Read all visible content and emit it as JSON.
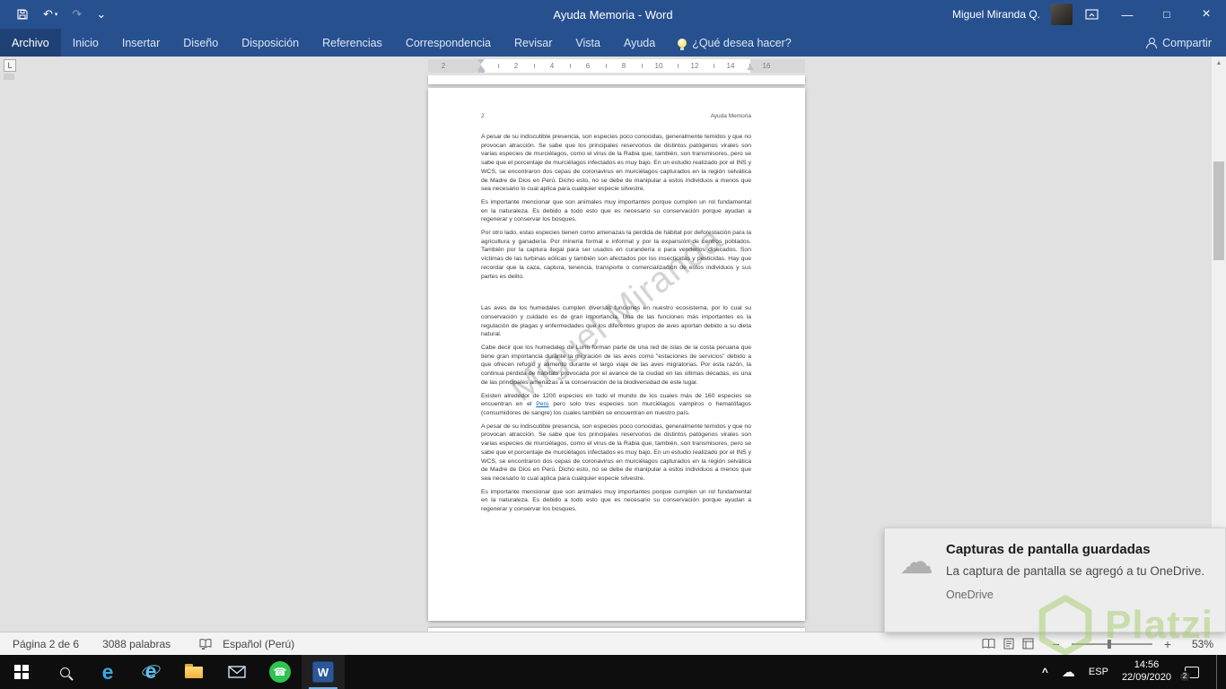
{
  "icons": {
    "undo": "↶",
    "redo": "↷",
    "undo_dropdown": "▾",
    "qat_dropdown": "⌄",
    "minimize": "—",
    "maximize": "□",
    "close": "×",
    "scroll_up": "▲",
    "scroll_down": "▼",
    "cloud": "☁",
    "phone": "☎",
    "tray_chevron": "^",
    "edge_letter": "e",
    "ie_letter": "e",
    "tab_selector": "L",
    "zoom_out": "−",
    "zoom_in": "+",
    "word_logo": "W"
  },
  "title_bar": {
    "title": "Ayuda Memoria - Word",
    "user_name": "Miguel Miranda Q."
  },
  "ribbon": {
    "tabs": [
      "Archivo",
      "Inicio",
      "Insertar",
      "Diseño",
      "Disposición",
      "Referencias",
      "Correspondencia",
      "Revisar",
      "Vista",
      "Ayuda"
    ],
    "tell_me": "¿Qué desea hacer?",
    "share": "Compartir"
  },
  "ruler": {
    "numbers": [
      "2",
      "2",
      "4",
      "6",
      "8",
      "10",
      "12",
      "14",
      "16"
    ]
  },
  "doc": {
    "header_page_number": "2",
    "header_title": "Ayuda Memoria",
    "watermark": "Miguel Miranda",
    "paragraphs": [
      "A pesar de su indiscutible presencia, son especies poco conocidas, generalmente temidos y que no provocan atracción. Se sabe que los principales reservorios de distintos patógenos virales son varias especies de murciélagos, como el virus de la Rabia que, también, son transmisores, pero se sabe que el porcentaje de murciélagos infectados es muy bajo. En un estudio realizado por el INS y WCS, se encontraron dos cepas de coronavirus en murciélagos capturados en la región selvática de Madre de Dios en Perú. Dicho esto, no se debe de manipular a estos individuos a menos que sea necesario lo cual aplica para cualquier especie silvestre.",
      "Es importante mencionar que son animales muy importantes porque cumplen un rol fundamental en la naturaleza. Es debido a todo esto que es necesario su conservación porque ayudan a regenerar y conservar los bosques.",
      "Por otro lado, estas especies tienen como amenazas la perdida de hábitat por deforestación para la agricultura y ganadería. Por minería formal e informal y por la expansión de centros poblados. También por la captura ilegal para ser usados en curandería o para venderlos disecados. Son víctimas de las turbinas eólicas y también son afectados por los insecticidas y pesticidas. Hay que recordar que la caza, captura, tenencia, transporte o comercialización de estos individuos y sus partes es delito.",
      "Las aves de los humedales cumplen diversas funciones en nuestro ecosistema, por lo cual su conservación y cuidado es de gran importancia. Una de las funciones más importantes es la regulación de plagas y enfermedades que los diferentes grupos de aves aportan debido a su dieta natural.",
      "Cabe decir que los humedales de Lurín forman parte de una red de islas de la costa peruana que tiene gran importancia durante la migración de las aves como \"estaciones de servicios\" debido a que ofrecen refugio y alimento durante el largo viaje de las aves migratorias. Por esta razón, la continua pérdida de hábitats provocada por el avance de la ciudad en las últimas décadas, es una de las principales amenazas a la conservación de la biodiversidad de este lugar.",
      "A pesar de su indiscutible presencia, son especies poco conocidas, generalmente temidos y que no provocan atracción. Se sabe que los principales reservorios de distintos patógenos virales son varias especies de murciélagos, como el virus de la Rabia que, también, son transmisores, pero se sabe que el porcentaje de murciélagos infectados es muy bajo. En un estudio realizado por el INS y WCS, se encontraron dos cepas de coronavirus en murciélagos capturados en la región selvática de Madre de Dios en Perú. Dicho esto, no se debe de manipular a estos individuos a menos que sea necesario lo cual aplica para cualquier especie silvestre.",
      "Es importante mencionar que son animales muy importantes porque cumplen un rol fundamental en la naturaleza. Es debido a todo esto que es necesario su conservación porque ayudan a regenerar y conservar los bosques."
    ],
    "link_paragraph": {
      "before": "Existen alrededor de 1200 especies en todo el mundo de los cuales más de 160 especies se encuentran en el ",
      "link": "Perú",
      "after": " pero solo tres especies son murciélagos vampiros o hematófagos (consumidores de sangre) los cuales también se encuentran en nuestro país."
    }
  },
  "notification": {
    "title": "Capturas de pantalla guardadas",
    "body": "La captura de pantalla se agregó a tu OneDrive.",
    "app": "OneDrive"
  },
  "status_bar": {
    "page_info": "Página 2 de 6",
    "word_count": "3088 palabras",
    "language": "Español (Perú)",
    "zoom_level": "53%"
  },
  "taskbar": {
    "language_indicator": "ESP",
    "time": "14:56",
    "date": "22/09/2020",
    "badge_count": "2"
  },
  "overlay": {
    "brand": "Platzi"
  }
}
